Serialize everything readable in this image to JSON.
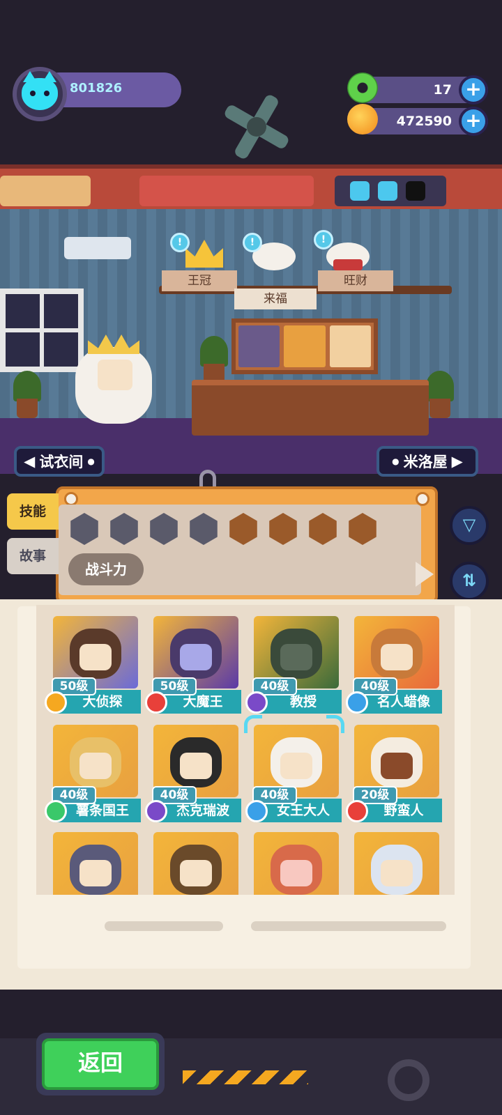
{
  "player": {
    "uid": "801826"
  },
  "resources": {
    "gems": {
      "value": "17",
      "icon": "donut-gem-icon"
    },
    "coins": {
      "value": "472590",
      "icon": "planet-coin-icon"
    }
  },
  "room": {
    "pets": [
      {
        "label": "王冠"
      },
      {
        "label": "来福"
      },
      {
        "label": "旺财"
      }
    ],
    "left_nav": "试衣间",
    "right_nav": "米洛屋"
  },
  "filter": {
    "tabs": [
      "技能",
      "故事"
    ],
    "power_label": "战斗力",
    "skill_icons": [
      "heart-icon",
      "bell-icon",
      "shield-icon",
      "anchor-icon",
      "wing-icon",
      "smile-icon",
      "muscle-icon",
      "brain-icon"
    ]
  },
  "characters": [
    {
      "level": "50级",
      "name": "大侦探"
    },
    {
      "level": "50级",
      "name": "大魔王"
    },
    {
      "level": "40级",
      "name": "教授"
    },
    {
      "level": "40级",
      "name": "名人蜡像"
    },
    {
      "level": "40级",
      "name": "薯条国王"
    },
    {
      "level": "40级",
      "name": "杰克瑞波"
    },
    {
      "level": "40级",
      "name": "女王大人"
    },
    {
      "level": "20级",
      "name": "野蛮人"
    }
  ],
  "buttons": {
    "back": "返回"
  },
  "colors": {
    "accent": "#25a5b0",
    "orange_panel": "#f2a64a",
    "back_green": "#3fd05a"
  }
}
